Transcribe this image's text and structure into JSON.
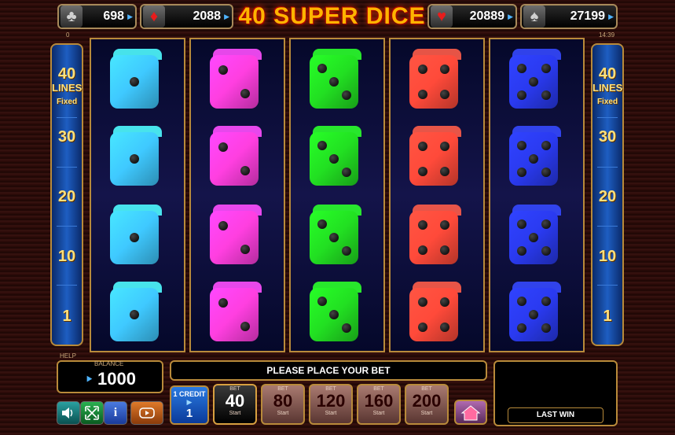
{
  "title": "40 SUPER DICE",
  "jackpots": [
    {
      "suit": "clubs",
      "symbol": "♣",
      "value": "698"
    },
    {
      "suit": "diamonds",
      "symbol": "♦",
      "value": "2088"
    },
    {
      "suit": "hearts",
      "symbol": "♥",
      "value": "20889"
    },
    {
      "suit": "spades",
      "symbol": "♠",
      "value": "27199"
    }
  ],
  "corner_left": "0",
  "clock": "14:39",
  "lines_panel": {
    "count": "40",
    "lines": "LINES",
    "fixed": "Fixed",
    "markers": [
      "30",
      "20",
      "10",
      "1"
    ]
  },
  "reels": [
    {
      "color": "#3fc9ff",
      "pips": [
        1,
        1,
        1,
        1
      ]
    },
    {
      "color": "#ff3fe0",
      "pips": [
        2,
        2,
        2,
        2
      ]
    },
    {
      "color": "#22e022",
      "pips": [
        3,
        3,
        3,
        3
      ]
    },
    {
      "color": "#ff4a3a",
      "pips": [
        4,
        4,
        4,
        4
      ]
    },
    {
      "color": "#2a3af0",
      "pips": [
        5,
        5,
        5,
        5
      ]
    }
  ],
  "help_label": "HELP",
  "balance": {
    "label": "BALANCE",
    "value": "1000"
  },
  "message": "PLEASE PLACE YOUR BET",
  "credit": {
    "label": "1 CREDIT",
    "value": "1"
  },
  "bets": [
    {
      "label": "BET",
      "value": "40",
      "start": "Start",
      "active": true
    },
    {
      "label": "BET",
      "value": "80",
      "start": "Start",
      "active": false
    },
    {
      "label": "BET",
      "value": "120",
      "start": "Start",
      "active": false
    },
    {
      "label": "BET",
      "value": "160",
      "start": "Start",
      "active": false
    },
    {
      "label": "BET",
      "value": "200",
      "start": "Start",
      "active": false
    }
  ],
  "last_win_label": "LAST WIN",
  "icons": {
    "sound": "speaker-icon",
    "fullscreen": "expand-icon",
    "info": "info-icon",
    "autoplay": "autoplay-icon",
    "home": "home-icon"
  }
}
